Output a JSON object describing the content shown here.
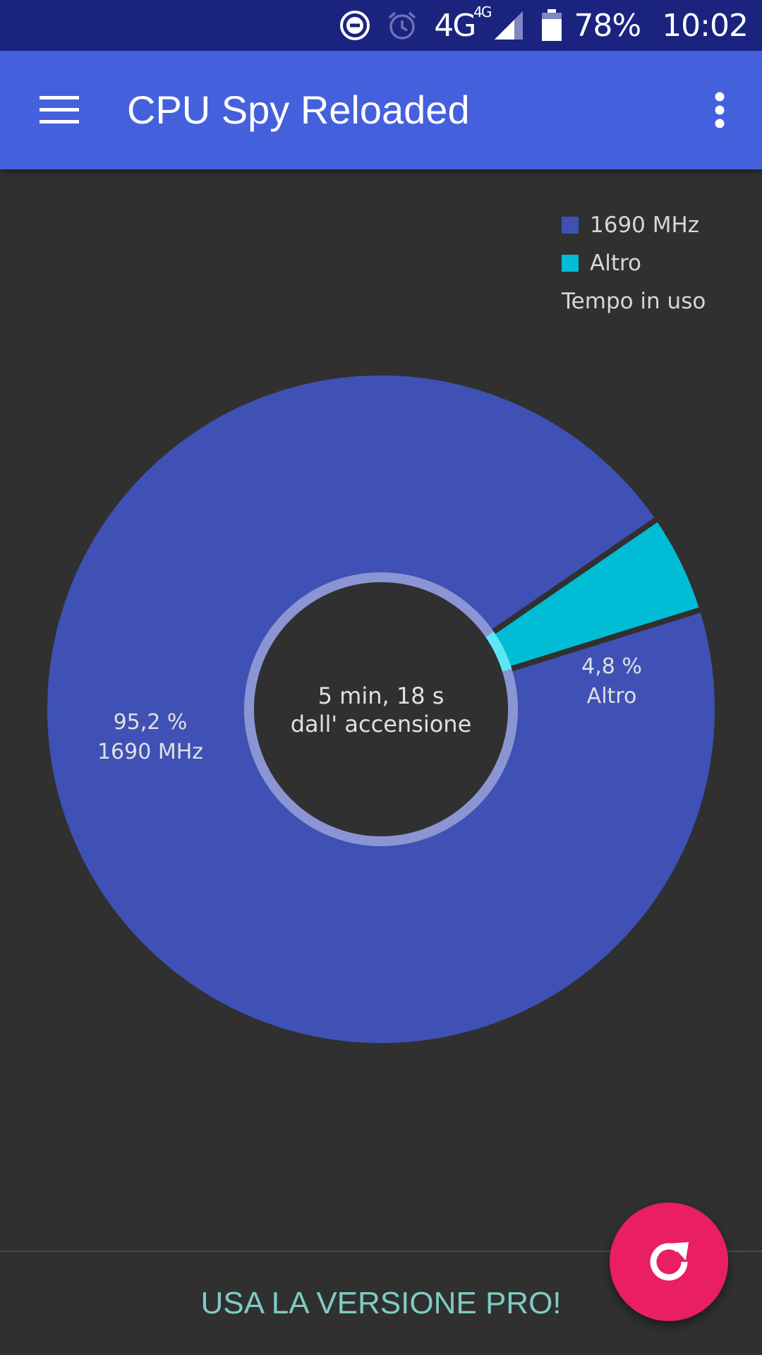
{
  "status_bar": {
    "network_label": "4G",
    "network_sup": "4G",
    "battery": "78%",
    "time": "10:02",
    "icons": [
      "dnd-icon",
      "alarm-icon",
      "signal-icon",
      "battery-icon"
    ]
  },
  "app_bar": {
    "title": "CPU Spy Reloaded",
    "color": "#4560dd",
    "icons": [
      "menu-icon",
      "overflow-icon"
    ]
  },
  "legend": {
    "items": [
      {
        "label": "1690 MHz",
        "color": "#3f51b5"
      },
      {
        "label": "Altro",
        "color": "#00bcd4"
      }
    ],
    "caption": "Tempo in uso"
  },
  "chart_data": {
    "type": "pie",
    "style": "donut",
    "categories": [
      "1690 MHz",
      "Altro"
    ],
    "values": [
      95.2,
      4.8
    ],
    "slice_labels": [
      {
        "percent": "95,2 %",
        "name": "1690 MHz"
      },
      {
        "percent": "4,8 %",
        "name": "Altro"
      }
    ],
    "colors": [
      "#3f51b5",
      "#00bcd4"
    ],
    "center_text": {
      "line1": "5 min, 18 s",
      "line2": "dall' accensione"
    },
    "legend_position": "top-right"
  },
  "bottom": {
    "pro_label": "USA LA VERSIONE PRO!",
    "pro_color": "#80cbc4"
  },
  "fab": {
    "icon": "refresh-icon",
    "color": "#e91e63"
  }
}
